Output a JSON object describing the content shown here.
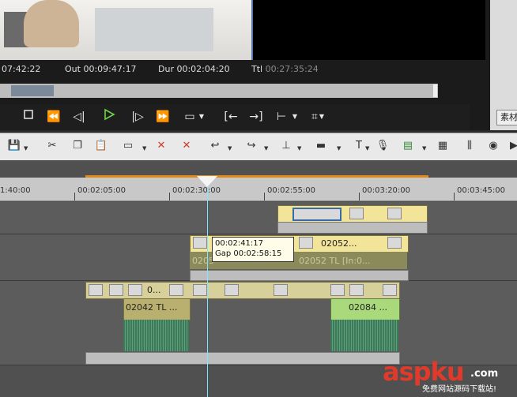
{
  "preview": {
    "timecodes": {
      "in_value": "07:42:22",
      "out_label": "Out",
      "out_value": "00:09:47:17",
      "dur_label": "Dur",
      "dur_value": "00:02:04:20",
      "ttl_label": "Ttl",
      "ttl_value": "00:27:35:24"
    },
    "right_tab_label": "素材"
  },
  "ruler": {
    "labels": [
      "1:40:00",
      "00:02:05:00",
      "00:02:30:00",
      "00:02:55:00",
      "00:03:20:00",
      "00:03:45:00"
    ]
  },
  "tracks": {
    "v1": {
      "clip_a_label": "02052...",
      "clip_a_sub": "02052  TL [In:0...",
      "clip_b_sub": "0205"
    },
    "va": {
      "clip_a_label": "0...",
      "clip_c_label": "02042  TL ...",
      "clip_d_label": "02084 ..."
    }
  },
  "tooltip": {
    "line1": "00:02:41:17",
    "line2": "Gap  00:02:58:15"
  },
  "watermark": {
    "brand": "aspku",
    "tld": ".com",
    "tagline": "免费网站源码下载站!"
  }
}
